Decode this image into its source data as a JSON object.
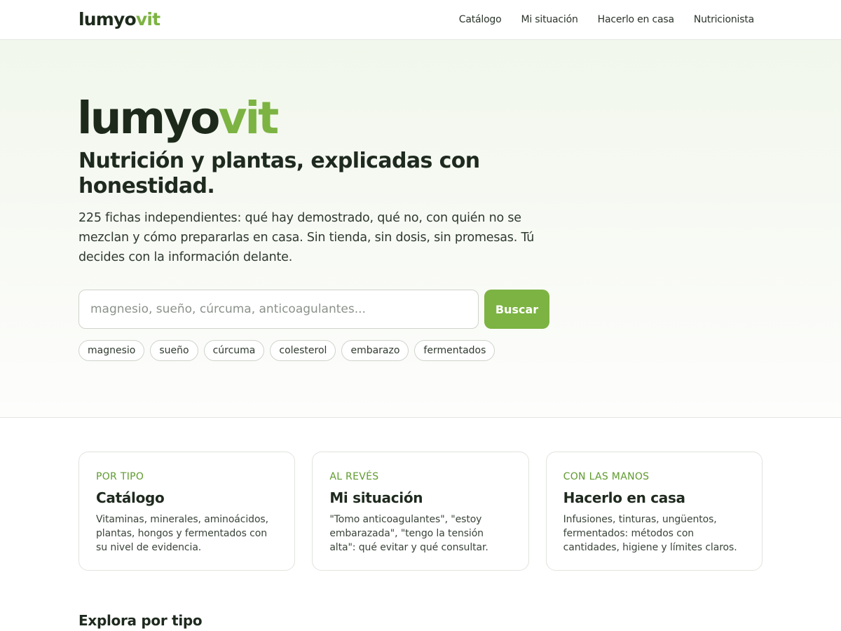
{
  "header": {
    "brand_main": "lumyo",
    "brand_accent": "vit",
    "nav": [
      {
        "label": "Catálogo"
      },
      {
        "label": "Mi situación"
      },
      {
        "label": "Hacerlo en casa"
      },
      {
        "label": "Nutricionista"
      }
    ]
  },
  "hero": {
    "brand_main": "lumyo",
    "brand_accent": "vit",
    "title": "Nutrición y plantas, explicadas con honestidad.",
    "description": "225 fichas independientes: qué hay demostrado, qué no, con quién no se mezclan y cómo prepararlas en casa. Sin tienda, sin dosis, sin promesas. Tú decides con la información delante.",
    "search": {
      "placeholder": "magnesio, sueño, cúrcuma, anticoagulantes...",
      "value": "",
      "button_label": "Buscar"
    },
    "chips": [
      "magnesio",
      "sueño",
      "cúrcuma",
      "colesterol",
      "embarazo",
      "fermentados"
    ]
  },
  "cards": [
    {
      "kicker": "POR TIPO",
      "title": "Catálogo",
      "description": "Vitaminas, minerales, aminoácidos, plantas, hongos y fermentados con su nivel de evidencia."
    },
    {
      "kicker": "AL REVÉS",
      "title": "Mi situación",
      "description": "\"Tomo anticoagulantes\", \"estoy embarazada\", \"tengo la tensión alta\": qué evitar y qué consultar."
    },
    {
      "kicker": "CON LAS MANOS",
      "title": "Hacerlo en casa",
      "description": "Infusiones, tinturas, ungüentos, fermentados: métodos con cantidades, higiene y límites claros."
    }
  ],
  "explore": {
    "title": "Explora por tipo"
  },
  "colors": {
    "accent": "#7cb342",
    "text": "#1f2a1f"
  }
}
